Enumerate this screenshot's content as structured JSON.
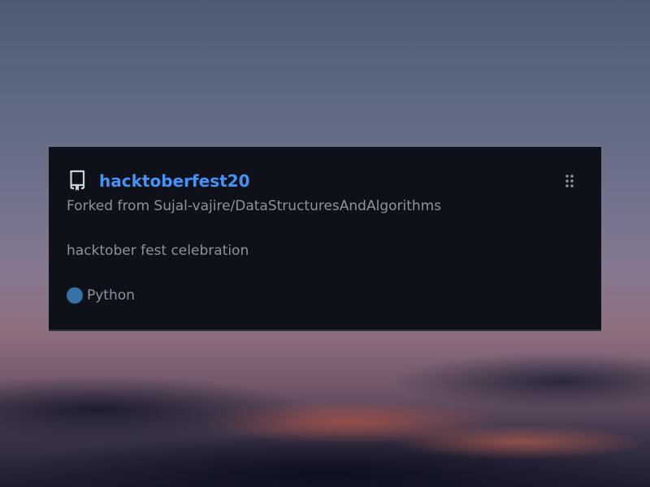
{
  "card": {
    "repo_name": "hacktoberfest20",
    "forked_from": "Forked from Sujal-vajire/DataStructuresAndAlgorithms",
    "description": "hacktober fest celebration",
    "language": "Python",
    "language_color": "#3572A5",
    "icons": {
      "repo": "repo-icon",
      "drag": "grabber-icon"
    }
  },
  "colors": {
    "link": "#4493f8",
    "card_background": "#0e1117",
    "muted_text": "#8b949e"
  }
}
